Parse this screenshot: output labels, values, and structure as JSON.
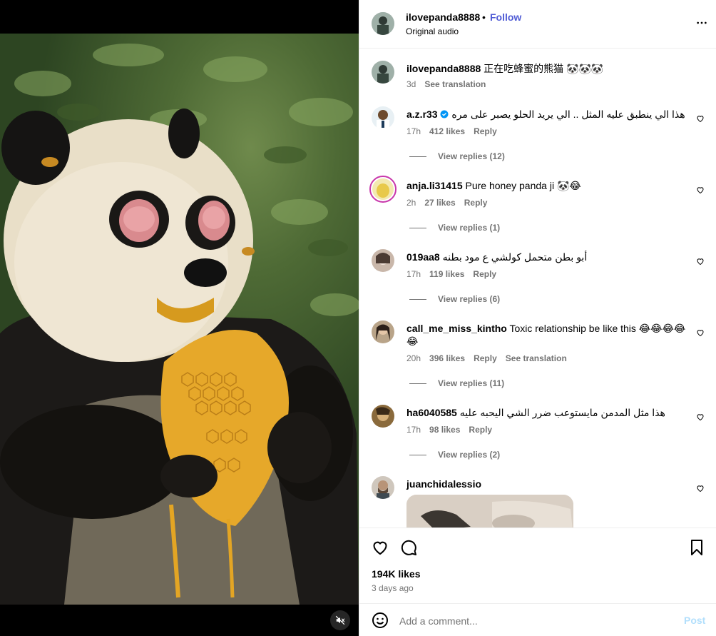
{
  "post": {
    "username": "ilovepanda8888",
    "follow_label": "Follow",
    "separator": "•",
    "audio_label": "Original audio",
    "caption_user": "ilovepanda8888",
    "caption_text": "正在吃蜂蜜的熊猫 🐼🐼🐼",
    "caption_time": "3d",
    "caption_translate": "See translation"
  },
  "comments": [
    {
      "user": "a.z.r33",
      "verified": true,
      "text": "هذا الي ينطبق عليه المثل .. الي يريد الحلو يصبر على مره",
      "rtl": true,
      "time": "17h",
      "likes": "412 likes",
      "reply": "Reply",
      "replies": "View replies (12)"
    },
    {
      "user": "anja.li31415",
      "text": "Pure honey panda ji 🐼😂",
      "time": "2h",
      "likes": "27 likes",
      "reply": "Reply",
      "replies": "View replies (1)"
    },
    {
      "user": "019aa8",
      "text": "أبو بطن متحمل كولشي ع مود بطنه",
      "rtl": true,
      "time": "17h",
      "likes": "119 likes",
      "reply": "Reply",
      "replies": "View replies (6)"
    },
    {
      "user": "call_me_miss_kintho",
      "text": "Toxic relationship be like this 😂😂😂😂",
      "text2": "😂",
      "time": "20h",
      "likes": "396 likes",
      "reply": "Reply",
      "translate": "See translation",
      "replies": "View replies (11)"
    },
    {
      "user": "ha6040585",
      "text": "هذا مثل المدمن مايستوعب ضرر الشي اليحبه عليه",
      "rtl": true,
      "time": "17h",
      "likes": "98 likes",
      "reply": "Reply",
      "replies": "View replies (2)"
    },
    {
      "user": "juanchidalessio",
      "text": ""
    }
  ],
  "stats": {
    "likes": "194K likes",
    "date": "3 days ago"
  },
  "composer": {
    "placeholder": "Add a comment...",
    "post_label": "Post"
  },
  "colors": {
    "accent": "#0095f6",
    "muted": "#737373",
    "post_disabled": "#b2dffc",
    "verified": "#0095f6"
  },
  "icons": [
    "more-options-icon",
    "heart-icon",
    "comment-icon",
    "save-icon",
    "emoji-icon",
    "mute-icon",
    "verified-icon"
  ]
}
